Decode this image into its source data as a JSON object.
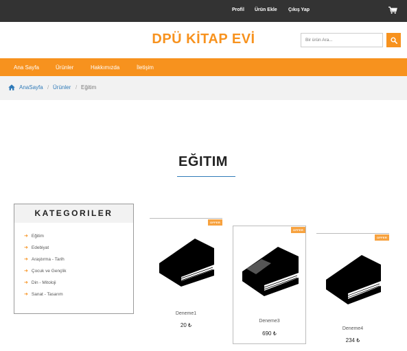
{
  "topbar": {
    "links": [
      "Profil",
      "Ürün Ekle",
      "Çıkış Yap"
    ],
    "cart_icon": "cart-icon"
  },
  "header": {
    "brand": "DPÜ KİTAP EVİ",
    "search_placeholder": "Bir ürün Ara...",
    "search_icon": "search-icon"
  },
  "nav": {
    "items": [
      "Ana Sayfa",
      "Ürünler",
      "Hakkımızda",
      "İletişim"
    ]
  },
  "breadcrumb": {
    "home_icon": "home-icon",
    "items": [
      "AnaSayfa",
      "Ürünler",
      "Eğitim"
    ],
    "separator": "/"
  },
  "section": {
    "title": "EĞITIM"
  },
  "categories": {
    "heading": "KATEGORILER",
    "items": [
      "Eğitim",
      "Edebiyat",
      "Araştırma - Tarih",
      "Çocuk ve Gençlik",
      "Din - Mitoloji",
      "Sanat - Tasarım"
    ]
  },
  "products": [
    {
      "badge": "OFFER",
      "name": "Deneme1",
      "price": "20 ₺"
    },
    {
      "badge": "OFFER",
      "name": "Deneme3",
      "price": "690 ₺"
    },
    {
      "badge": "OFFER",
      "name": "Deneme4",
      "price": "234 ₺"
    }
  ],
  "colors": {
    "accent": "#f7921e",
    "topbar": "#333333",
    "link": "#2f7ab8"
  }
}
